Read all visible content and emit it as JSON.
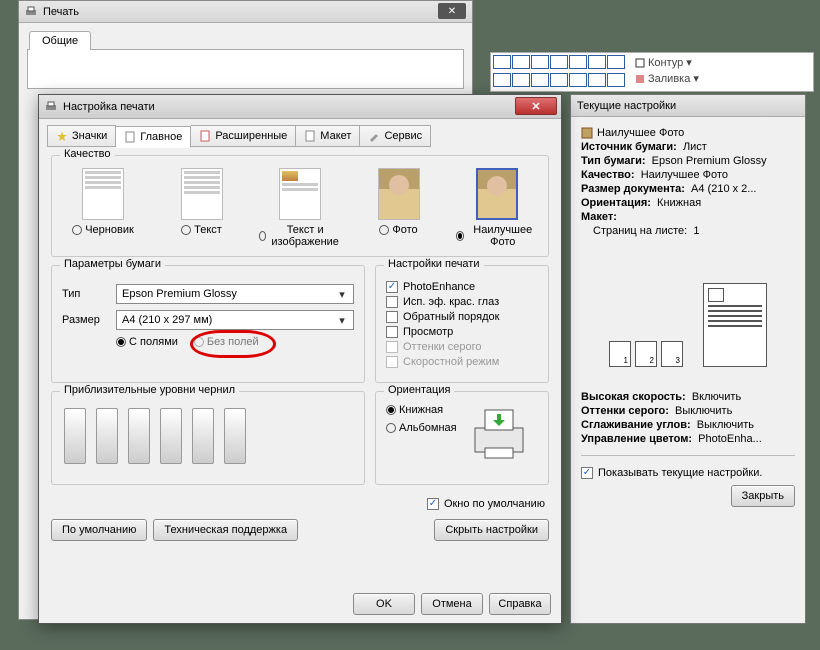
{
  "ribbon": {
    "outline": "Контур",
    "fill": "Заливка"
  },
  "print_window": {
    "title": "Печать",
    "tab": "Общие"
  },
  "dialog": {
    "title": "Настройка печати",
    "tabs": {
      "icons": "Значки",
      "main": "Главное",
      "advanced": "Расширенные",
      "layout": "Макет",
      "service": "Сервис"
    },
    "quality": {
      "legend": "Качество",
      "draft": "Черновик",
      "text": "Текст",
      "textimage": "Текст и изображение",
      "photo": "Фото",
      "best": "Наилучшее Фото"
    },
    "paper": {
      "legend": "Параметры бумаги",
      "type_label": "Тип",
      "type_value": "Epson Premium Glossy",
      "size_label": "Размер",
      "size_value": "A4 (210 x 297 мм)",
      "margins": "С полями",
      "borderless": "Без полей"
    },
    "print_settings": {
      "legend": "Настройки печати",
      "photoenhance": "PhotoEnhance",
      "redeye": "Исп. эф. крас. глаз",
      "reverse": "Обратный порядок",
      "preview": "Просмотр",
      "grayscale": "Оттенки серого",
      "speed": "Скоростной режим"
    },
    "ink": {
      "legend": "Приблизительные уровни чернил"
    },
    "orientation": {
      "legend": "Ориентация",
      "portrait": "Книжная",
      "landscape": "Альбомная"
    },
    "default_window": "Окно по умолчанию",
    "btn_defaults": "По умолчанию",
    "btn_support": "Техническая поддержка",
    "btn_hide": "Скрыть настройки",
    "btn_ok": "OK",
    "btn_cancel": "Отмена",
    "btn_help": "Справка"
  },
  "side": {
    "title": "Текущие настройки",
    "preset": "Наилучшее Фото",
    "source_lbl": "Источник бумаги:",
    "source_val": "Лист",
    "type_lbl": "Тип бумаги:",
    "type_val": "Epson Premium Glossy",
    "quality_lbl": "Качество:",
    "quality_val": "Наилучшее Фото",
    "size_lbl": "Размер документа:",
    "size_val": "A4 (210 x 2...",
    "orient_lbl": "Ориентация:",
    "orient_val": "Книжная",
    "layout_lbl": "Макет:",
    "pages_lbl": "Страниц на листе:",
    "pages_val": "1",
    "highspeed_lbl": "Высокая скорость:",
    "highspeed_val": "Включить",
    "gray_lbl": "Оттенки серого:",
    "gray_val": "Выключить",
    "smooth_lbl": "Сглаживание углов:",
    "smooth_val": "Выключить",
    "color_lbl": "Управление цветом:",
    "color_val": "PhotoEnha...",
    "show_current": "Показывать текущие настройки.",
    "btn_close": "Закрыть"
  }
}
